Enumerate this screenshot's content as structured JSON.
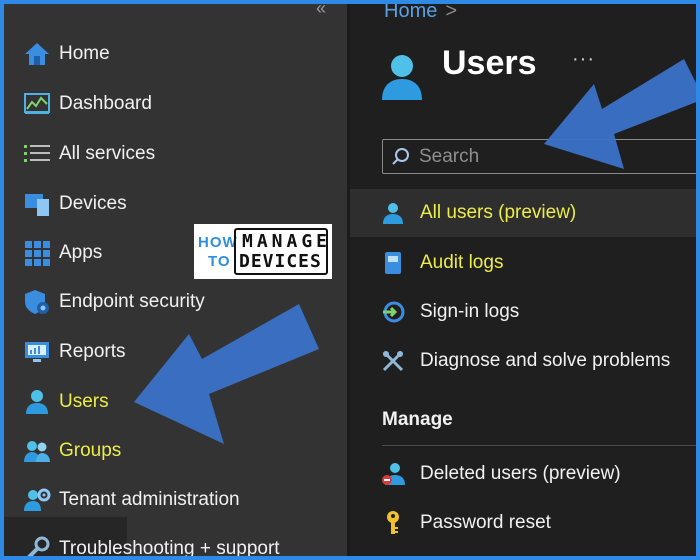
{
  "sidebar": {
    "collapse_glyph": "«",
    "items": [
      {
        "label": "Home",
        "icon": "home-icon"
      },
      {
        "label": "Dashboard",
        "icon": "dashboard-icon"
      },
      {
        "label": "All services",
        "icon": "list-icon"
      },
      {
        "label": "Devices",
        "icon": "devices-icon"
      },
      {
        "label": "Apps",
        "icon": "apps-grid-icon"
      },
      {
        "label": "Endpoint security",
        "icon": "shield-icon"
      },
      {
        "label": "Reports",
        "icon": "reports-icon"
      },
      {
        "label": "Users",
        "icon": "user-icon",
        "highlight": true
      },
      {
        "label": "Groups",
        "icon": "groups-icon",
        "highlight": true
      },
      {
        "label": "Tenant administration",
        "icon": "tenant-admin-icon"
      },
      {
        "label": "Troubleshooting + support",
        "icon": "wrench-icon"
      }
    ]
  },
  "main": {
    "breadcrumb": {
      "home": "Home",
      "separator": ">"
    },
    "title": "Users",
    "more": "···",
    "search": {
      "placeholder": "Search",
      "value": ""
    },
    "items": [
      {
        "label": "All users (preview)",
        "icon": "user-icon",
        "highlight": true,
        "selected": true
      },
      {
        "label": "Audit logs",
        "icon": "audit-log-icon",
        "highlight": true
      },
      {
        "label": "Sign-in logs",
        "icon": "sign-in-icon"
      },
      {
        "label": "Diagnose and solve problems",
        "icon": "tools-icon"
      }
    ],
    "manage_heading": "Manage",
    "manage_items": [
      {
        "label": "Deleted users (preview)",
        "icon": "deleted-user-icon"
      },
      {
        "label": "Password reset",
        "icon": "key-icon"
      }
    ]
  },
  "logo": {
    "how": "HOW",
    "to": "TO",
    "manage": "MANAGE",
    "devices": "DEVICES"
  },
  "colors": {
    "accent_blue": "#2f8ae6",
    "highlight_yellow": "#ecec4a",
    "arrow_blue": "#3a72c8"
  }
}
